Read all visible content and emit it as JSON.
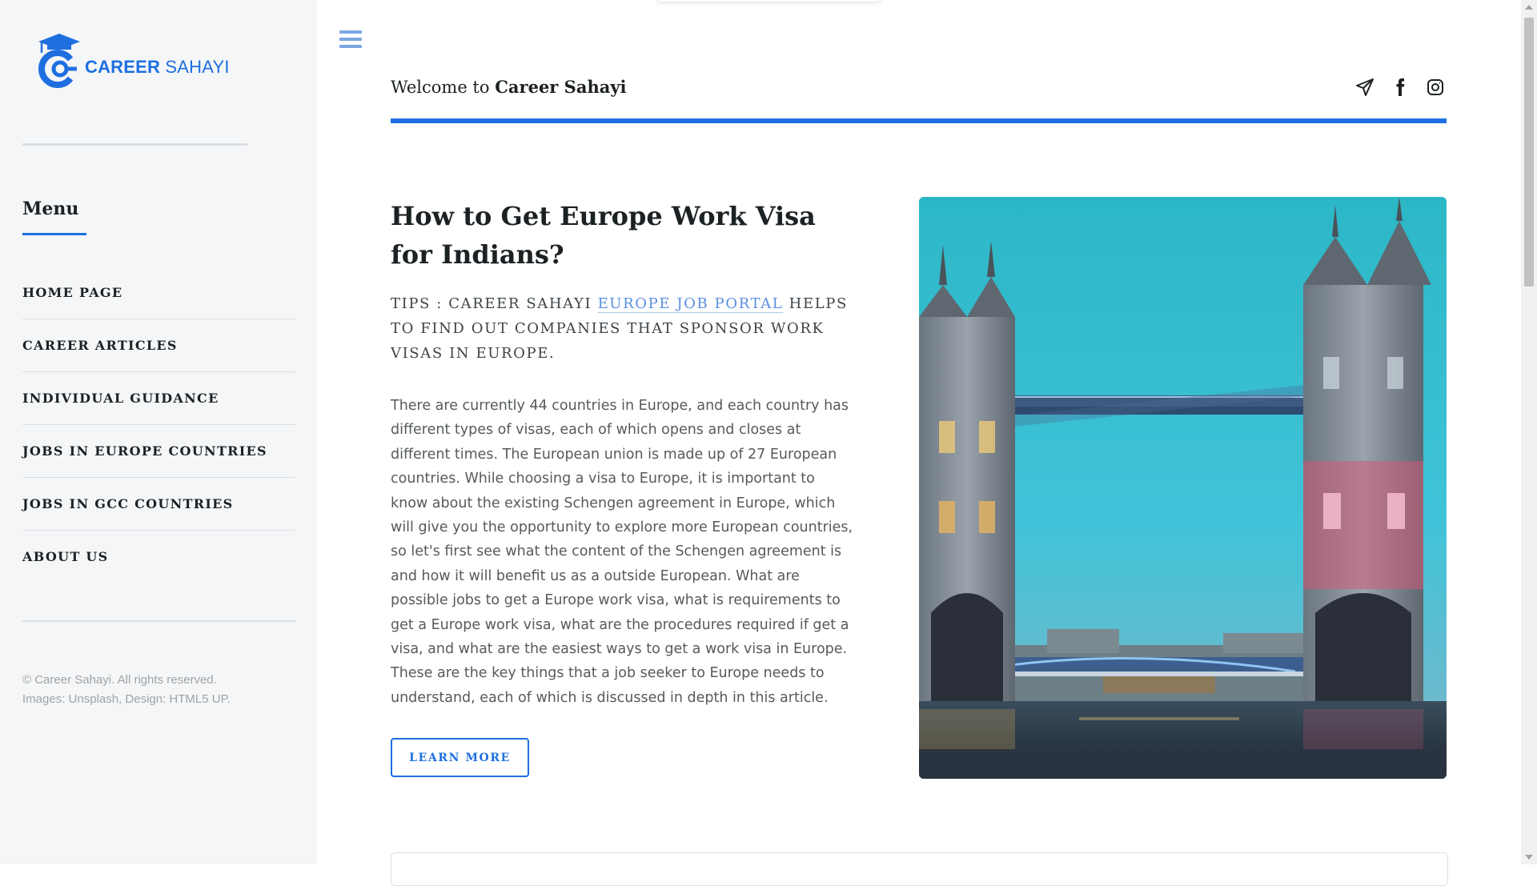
{
  "brand": {
    "name_bold": "CAREER",
    "name_light": " SAHAYI",
    "accent_color": "#1e6fe0"
  },
  "sidebar": {
    "menu_heading": "Menu",
    "items": [
      {
        "label": "HOME PAGE"
      },
      {
        "label": "CAREER ARTICLES"
      },
      {
        "label": "INDIVIDUAL GUIDANCE"
      },
      {
        "label": "JOBS IN EUROPE COUNTRIES"
      },
      {
        "label": "JOBS IN GCC COUNTRIES"
      },
      {
        "label": "ABOUT US"
      }
    ],
    "footer_line1": "© Career Sahayi. All rights reserved.",
    "footer_line2": "Images: Unsplash, Design: HTML5 UP."
  },
  "header": {
    "welcome_prefix": "Welcome to ",
    "welcome_site": "Career Sahayi",
    "social_icons": [
      "telegram-icon",
      "facebook-icon",
      "instagram-icon"
    ]
  },
  "article": {
    "title_line1": "How to Get Europe Work Visa",
    "title_line2": "for Indians?",
    "tips_prefix": "TIPS : CAREER SAHAYI ",
    "tips_link": "EUROPE JOB PORTAL",
    "tips_suffix": " HELPS TO FIND OUT COMPANIES THAT SPONSOR WORK VISAS IN EUROPE.",
    "body": "There are currently 44 countries in Europe, and each country has different types of visas, each of which opens and closes at different times. The European union is made up of 27 European countries. While choosing a visa to Europe, it is important to know about the existing Schengen agreement in Europe, which will give you the opportunity to explore more European countries, so let's first see what the content of the Schengen agreement is and how it will benefit us as a outside European. What are possible jobs to get a Europe work visa, what is requirements to get a Europe work visa, what are the procedures required if get a visa, and what are the easiest ways to get a work visa in Europe. These are the key things that a job seeker to Europe needs to understand, each of which is discussed in depth in this article.",
    "button_label": "LEARN MORE"
  }
}
